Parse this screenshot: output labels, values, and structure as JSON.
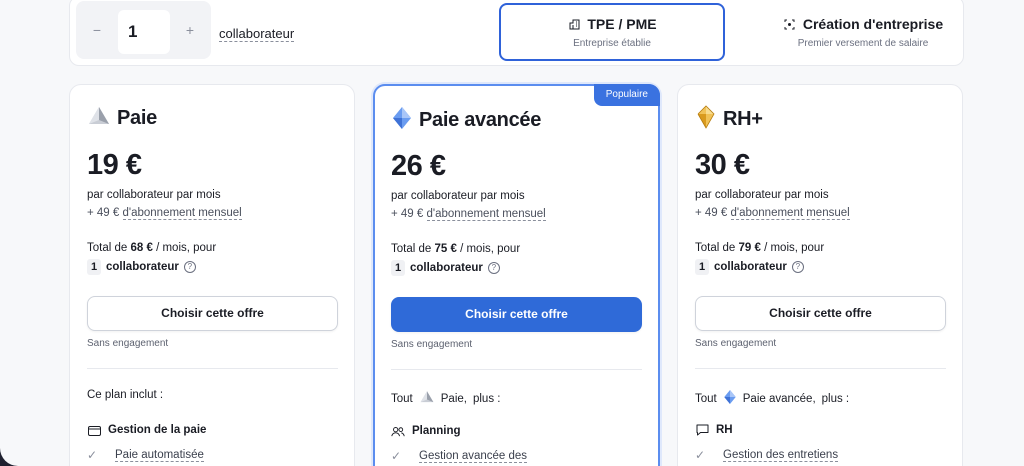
{
  "topbar": {
    "stepper": {
      "minus": "−",
      "value": "1",
      "plus": "+"
    },
    "unit_label": "collaborateur",
    "tabs": [
      {
        "title": "TPE / PME",
        "subtitle": "Entreprise établie",
        "icon": "building-icon",
        "active": true
      },
      {
        "title": "Création d'entreprise",
        "subtitle": "Premier versement de salaire",
        "icon": "focus-icon",
        "active": false
      }
    ]
  },
  "plans": [
    {
      "name": "Paie",
      "icon": "grey-pyramid-icon",
      "price": "19 €",
      "per_line": "par collaborateur par mois",
      "sub_prefix": "+ 49 €",
      "sub_link": "d'abonnement mensuel",
      "total_pre": "Total de",
      "total_amount": "68 €",
      "total_post": "/ mois, pour",
      "count": "1",
      "count_word": "collaborateur",
      "cta": "Choisir cette offre",
      "no_engage": "Sans engagement",
      "includes": "Ce plan inclut :",
      "feature": "Gestion de la paie",
      "feature_icon": "wallet-icon",
      "sub_feature": "Paie automatisée"
    },
    {
      "name": "Paie avancée",
      "icon": "blue-gem-icon",
      "price": "26 €",
      "badge": "Populaire",
      "per_line": "par collaborateur par mois",
      "sub_prefix": "+ 49 €",
      "sub_link": "d'abonnement mensuel",
      "total_pre": "Total de",
      "total_amount": "75 €",
      "total_post": "/ mois, pour",
      "count": "1",
      "count_word": "collaborateur",
      "cta": "Choisir cette offre",
      "no_engage": "Sans engagement",
      "includes_pre": "Tout",
      "includes_plan": "Paie,",
      "includes_post": "plus :",
      "feature": "Planning",
      "feature_icon": "users-icon",
      "sub_feature": "Gestion avancée des"
    },
    {
      "name": "RH+",
      "icon": "gold-gem-icon",
      "price": "30 €",
      "per_line": "par collaborateur par mois",
      "sub_prefix": "+ 49 €",
      "sub_link": "d'abonnement mensuel",
      "total_pre": "Total de",
      "total_amount": "79 €",
      "total_post": "/ mois, pour",
      "count": "1",
      "count_word": "collaborateur",
      "cta": "Choisir cette offre",
      "no_engage": "Sans engagement",
      "includes_pre": "Tout",
      "includes_plan": "Paie avancée,",
      "includes_post": "plus :",
      "feature": "RH",
      "feature_icon": "chat-icon",
      "sub_feature": "Gestion des entretiens"
    }
  ],
  "colors": {
    "accent": "#2f6ad8",
    "badge": "#3a72e0",
    "frame": "#1f2130"
  }
}
